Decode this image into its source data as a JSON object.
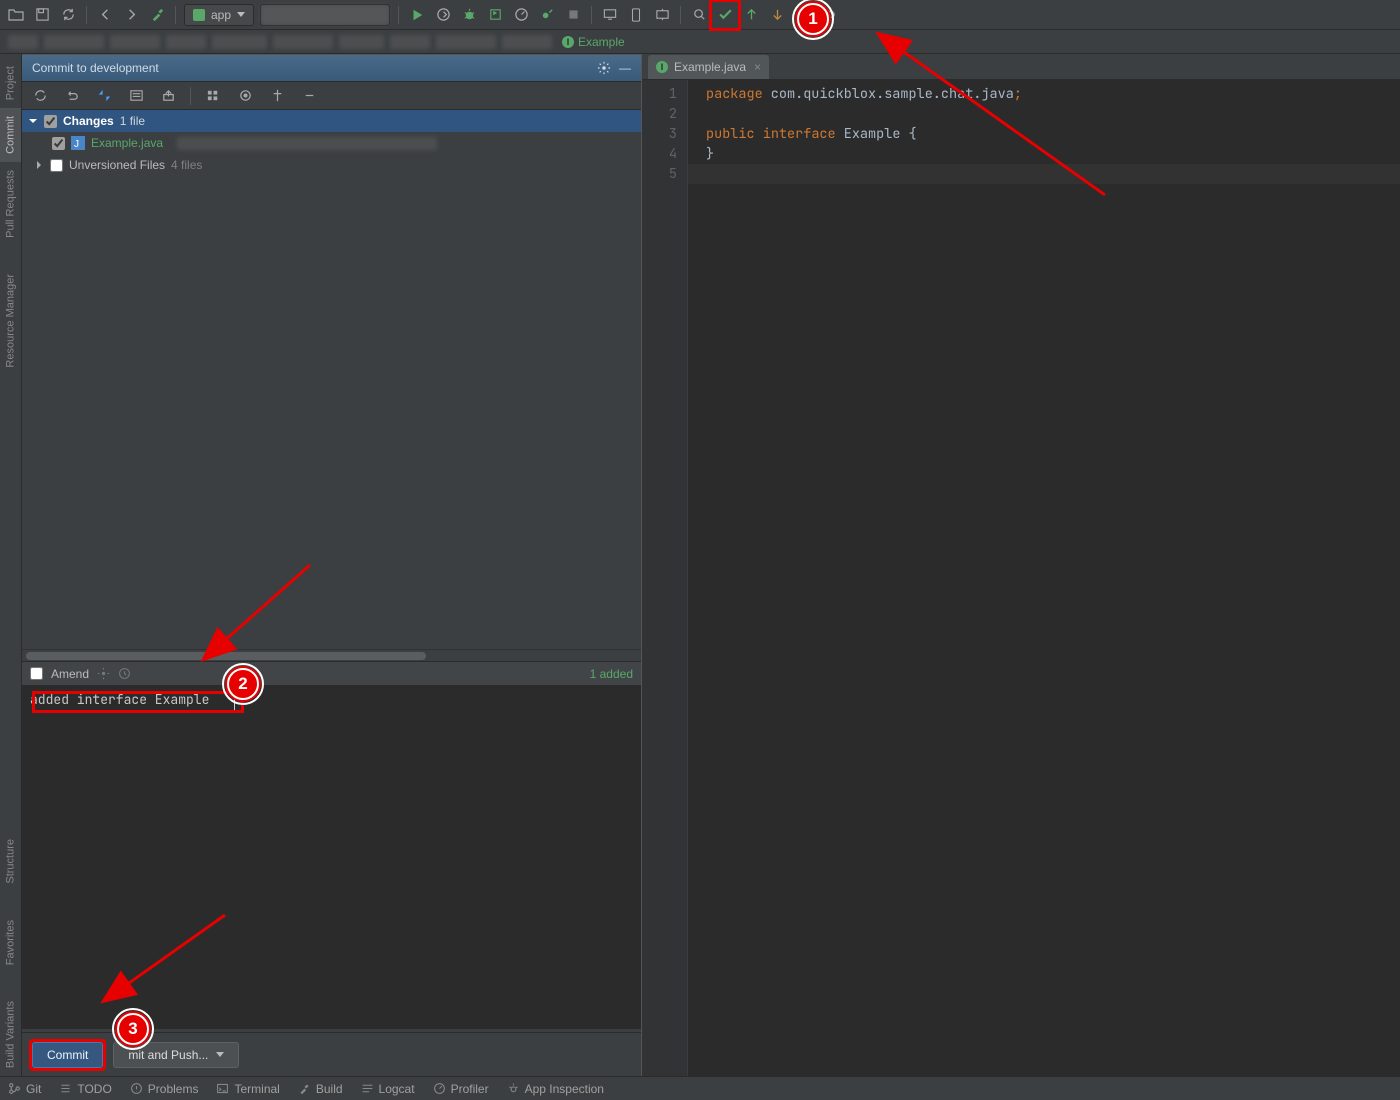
{
  "toolbar": {
    "app_selector": "app"
  },
  "breadcrumb": {
    "example_label": "Example"
  },
  "commit_panel": {
    "title": "Commit to development",
    "changes_label": "Changes",
    "changes_count": "1 file",
    "changed_file": "Example.java",
    "unversioned_label": "Unversioned Files",
    "unversioned_count": "4 files",
    "amend_label": "Amend",
    "added_count": "1 added",
    "commit_message": "added interface Example",
    "commit_btn": "Commit",
    "commit_push_btn": "mit and Push..."
  },
  "editor": {
    "tab_name": "Example.java",
    "gutter": [
      "1",
      "2",
      "3",
      "4",
      "5"
    ],
    "line1_kw": "package",
    "line1_rest": " com.quickblox.sample.chat.java",
    "line3_kw1": "public",
    "line3_kw2": "interface",
    "line3_name": "Example",
    "line3_brace": "{",
    "line4_brace": "}"
  },
  "bottom": {
    "git": "Git",
    "todo": "TODO",
    "problems": "Problems",
    "terminal": "Terminal",
    "build": "Build",
    "logcat": "Logcat",
    "profiler": "Profiler",
    "appinsp": "App Inspection"
  },
  "sidebar": {
    "project": "Project",
    "commit": "Commit",
    "pull": "Pull Requests",
    "resource": "Resource Manager",
    "structure": "Structure",
    "favorites": "Favorites",
    "build": "Build Variants"
  },
  "callouts": {
    "one": "1",
    "two": "2",
    "three": "3"
  }
}
